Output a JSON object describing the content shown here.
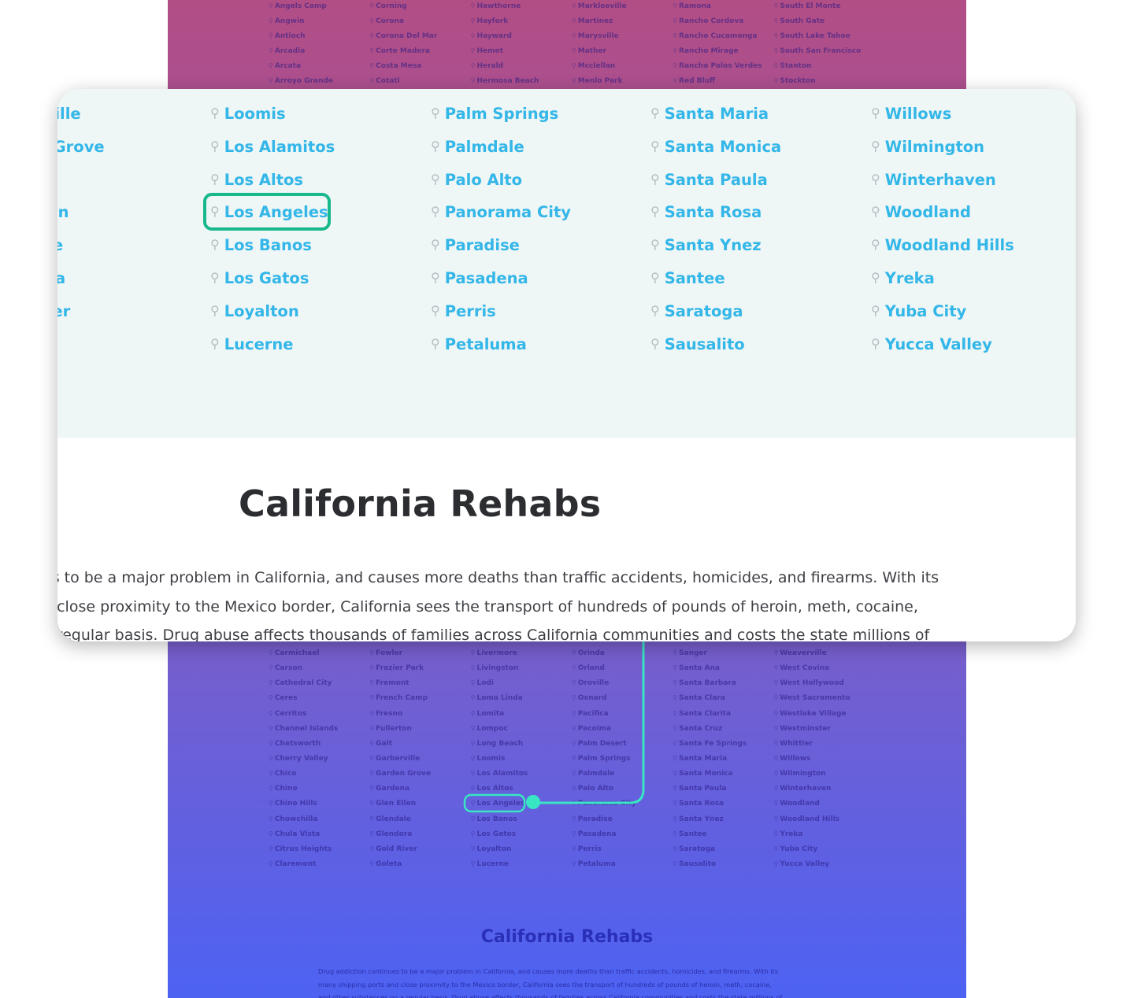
{
  "colors": {
    "highlight": "#17b88b",
    "city_link": "#33b6e8",
    "connector": "#38e6c3"
  },
  "icons": {
    "pin": "map-pin-icon"
  },
  "background_page": {
    "top_columns": [
      [
        "Angels Camp",
        "Angwin",
        "Antioch",
        "Arcadia",
        "Arcata",
        "Arroyo Grande"
      ],
      [
        "Corning",
        "Corona",
        "Corona Del Mar",
        "Corte Madera",
        "Costa Mesa",
        "Cotati"
      ],
      [
        "Hawthorne",
        "Hayfork",
        "Hayward",
        "Hemet",
        "Herald",
        "Hermosa Beach"
      ],
      [
        "Markleeville",
        "Martinez",
        "Marysville",
        "Mather",
        "Mcclellan",
        "Menlo Park"
      ],
      [
        "Ramona",
        "Rancho Cordova",
        "Rancho Cucamonga",
        "Rancho Mirage",
        "Rancho Palos Verdes",
        "Red Bluff"
      ],
      [
        "South El Monte",
        "South Gate",
        "South Lake Tahoe",
        "South San Francisco",
        "Stanton",
        "Stockton"
      ]
    ],
    "bottom_columns": [
      [
        "Carmichael",
        "Carson",
        "Cathedral City",
        "Ceres",
        "Cerritos",
        "Channel Islands",
        "Chatsworth",
        "Cherry Valley",
        "Chico",
        "Chino",
        "Chino Hills",
        "Chowchilla",
        "Chula Vista",
        "Citrus Heights",
        "Claremont"
      ],
      [
        "Fowler",
        "Frazier Park",
        "Fremont",
        "French Camp",
        "Fresno",
        "Fullerton",
        "Galt",
        "Garberville",
        "Garden Grove",
        "Gardena",
        "Glen Ellen",
        "Glendale",
        "Glendora",
        "Gold River",
        "Goleta"
      ],
      [
        "Livermore",
        "Livingston",
        "Lodi",
        "Loma Linda",
        "Lomita",
        "Lompoc",
        "Long Beach",
        "Loomis",
        "Los Alamitos",
        "Los Altos",
        "Los Angeles",
        "Los Banos",
        "Los Gatos",
        "Loyalton",
        "Lucerne"
      ],
      [
        "Orinda",
        "Orland",
        "Oroville",
        "Oxnard",
        "Pacifica",
        "Pacoima",
        "Palm Desert",
        "Palm Springs",
        "Palmdale",
        "Palo Alto",
        "Panorama City",
        "Paradise",
        "Pasadena",
        "Perris",
        "Petaluma"
      ],
      [
        "Sanger",
        "Santa Ana",
        "Santa Barbara",
        "Santa Clara",
        "Santa Clarita",
        "Santa Cruz",
        "Santa Fe Springs",
        "Santa Maria",
        "Santa Monica",
        "Santa Paula",
        "Santa Rosa",
        "Santa Ynez",
        "Santee",
        "Saratoga",
        "Sausalito"
      ],
      [
        "Weaverville",
        "West Covina",
        "West Hollywood",
        "West Sacramento",
        "Westlake Village",
        "Westminster",
        "Whittier",
        "Willows",
        "Wilmington",
        "Winterhaven",
        "Woodland",
        "Woodland Hills",
        "Yreka",
        "Yuba City",
        "Yucca Valley"
      ]
    ],
    "title": "California Rehabs",
    "paragraph_lines": [
      "Drug addiction continues to be a major problem in California, and causes more deaths than traffic accidents, homicides, and firearms. With its",
      "many shipping ports and close proximity to the Mexico border, California sees the transport of hundreds of pounds of heroin, meth, cocaine,",
      "and other substances on a regular basis. Drug abuse affects thousands of families across California communities and costs the state millions of"
    ]
  },
  "zoom": {
    "columns": [
      [
        "rville",
        "n Grove",
        "na",
        "llen",
        "ale",
        "ora",
        "iver"
      ],
      [
        "Loomis",
        "Los Alamitos",
        "Los Altos",
        "Los Angeles",
        "Los Banos",
        "Los Gatos",
        "Loyalton",
        "Lucerne"
      ],
      [
        "Palm Springs",
        "Palmdale",
        "Palo Alto",
        "Panorama City",
        "Paradise",
        "Pasadena",
        "Perris",
        "Petaluma"
      ],
      [
        "Santa Maria",
        "Santa Monica",
        "Santa Paula",
        "Santa Rosa",
        "Santa Ynez",
        "Santee",
        "Saratoga",
        "Sausalito"
      ],
      [
        "Willows",
        "Wilmington",
        "Winterhaven",
        "Woodland",
        "Woodland Hills",
        "Yreka",
        "Yuba City",
        "Yucca Valley"
      ]
    ],
    "highlighted_city": "Los Angeles",
    "title": "California Rehabs",
    "paragraph_lines": [
      "es to be a major problem in California, and causes more deaths than traffic accidents, homicides, and firearms. With its",
      "d close proximity to the Mexico border, California sees the transport of hundreds of pounds of heroin, meth, cocaine,",
      "a regular basis. Drug abuse affects thousands of families across California communities and costs the state millions of"
    ]
  }
}
